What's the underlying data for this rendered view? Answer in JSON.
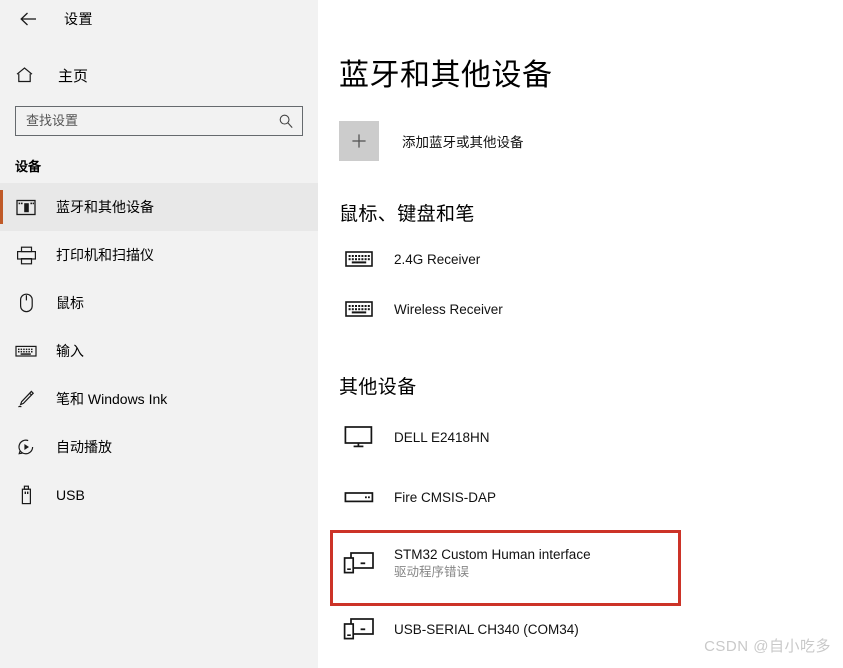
{
  "window": {
    "title": "设置",
    "back_icon": "back-arrow-icon"
  },
  "sidebar": {
    "home": {
      "label": "主页",
      "icon": "home-icon"
    },
    "search": {
      "placeholder": "查找设置",
      "value": "",
      "icon": "search-icon"
    },
    "section_label": "设备",
    "items": [
      {
        "label": "蓝牙和其他设备",
        "icon": "bluetooth-device-icon",
        "selected": true
      },
      {
        "label": "打印机和扫描仪",
        "icon": "printer-icon",
        "selected": false
      },
      {
        "label": "鼠标",
        "icon": "mouse-icon",
        "selected": false
      },
      {
        "label": "输入",
        "icon": "keyboard-icon",
        "selected": false
      },
      {
        "label": "笔和 Windows Ink",
        "icon": "pen-icon",
        "selected": false
      },
      {
        "label": "自动播放",
        "icon": "autoplay-icon",
        "selected": false
      },
      {
        "label": "USB",
        "icon": "usb-icon",
        "selected": false
      }
    ],
    "accent_color": "#c05a28",
    "background_color": "#f2f2f2"
  },
  "main": {
    "page_title": "蓝牙和其他设备",
    "add_device": {
      "label": "添加蓝牙或其他设备",
      "icon": "plus-icon"
    },
    "groups": [
      {
        "title": "鼠标、键盘和笔",
        "devices": [
          {
            "name": "2.4G Receiver",
            "status": "",
            "icon": "keyboard-icon"
          },
          {
            "name": "Wireless Receiver",
            "status": "",
            "icon": "keyboard-icon"
          }
        ]
      },
      {
        "title": "其他设备",
        "devices": [
          {
            "name": "DELL E2418HN",
            "status": "",
            "icon": "monitor-icon",
            "highlighted": false
          },
          {
            "name": "Fire CMSIS-DAP",
            "status": "",
            "icon": "device-box-icon",
            "highlighted": false
          },
          {
            "name": "STM32 Custom Human interface",
            "status": "驱动程序错误",
            "icon": "devices-icon",
            "highlighted": true
          },
          {
            "name": "USB-SERIAL CH340 (COM34)",
            "status": "",
            "icon": "devices-icon",
            "highlighted": false
          }
        ]
      }
    ],
    "annotation": {
      "type": "red-rectangle",
      "color": "#cc3328"
    }
  },
  "watermark": {
    "text": "CSDN @自小吃多"
  }
}
